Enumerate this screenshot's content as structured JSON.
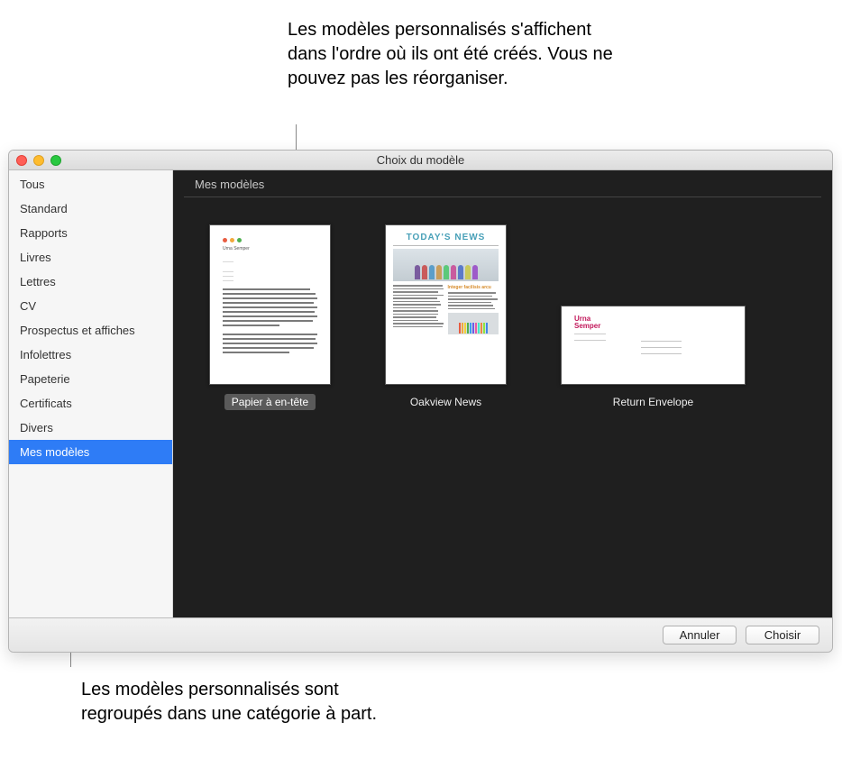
{
  "callouts": {
    "top": "Les modèles personnalisés s'affichent dans l'ordre où ils ont été créés. Vous ne pouvez pas les réorganiser.",
    "bottom": "Les modèles personnalisés sont regroupés dans une catégorie à part."
  },
  "window": {
    "title": "Choix du modèle"
  },
  "sidebar": {
    "items": [
      {
        "label": "Tous",
        "selected": false
      },
      {
        "label": "Standard",
        "selected": false
      },
      {
        "label": "Rapports",
        "selected": false
      },
      {
        "label": "Livres",
        "selected": false
      },
      {
        "label": "Lettres",
        "selected": false
      },
      {
        "label": "CV",
        "selected": false
      },
      {
        "label": "Prospectus et affiches",
        "selected": false
      },
      {
        "label": "Infolettres",
        "selected": false
      },
      {
        "label": "Papeterie",
        "selected": false
      },
      {
        "label": "Certificats",
        "selected": false
      },
      {
        "label": "Divers",
        "selected": false
      },
      {
        "label": "Mes modèles",
        "selected": true
      }
    ]
  },
  "content": {
    "section_header": "Mes modèles",
    "templates": [
      {
        "label": "Papier à en-tête",
        "selected": true,
        "kind": "letterhead"
      },
      {
        "label": "Oakview News",
        "selected": false,
        "kind": "newsletter"
      },
      {
        "label": "Return Envelope",
        "selected": false,
        "kind": "envelope"
      }
    ]
  },
  "thumbs": {
    "letterhead": {
      "dots": [
        "#e85c41",
        "#f2a93c",
        "#4fb04f"
      ],
      "name": "Urna Semper",
      "body_widths": [
        92,
        98,
        100,
        96,
        100,
        97,
        100,
        95,
        60,
        0,
        100,
        98,
        100,
        96,
        70
      ]
    },
    "newsletter": {
      "title": "TODAY'S NEWS",
      "headline": "Integer facilisis arcu",
      "people_colors": [
        "#7a5c9e",
        "#c95b5b",
        "#5b9ec9",
        "#c99e5b",
        "#5bc97a",
        "#c95b9e",
        "#5b7ac9",
        "#c9c95b",
        "#9e5bc9"
      ],
      "pencil_colors": [
        "#e85c41",
        "#f2a93c",
        "#f0d23c",
        "#4fb04f",
        "#3c9ef0",
        "#6a5ce8",
        "#e85ca3",
        "#41e8c9",
        "#e88b41",
        "#8be841",
        "#4188e8"
      ]
    },
    "envelope": {
      "name1": "Urna",
      "name2": "Semper"
    }
  },
  "footer": {
    "cancel": "Annuler",
    "choose": "Choisir"
  }
}
